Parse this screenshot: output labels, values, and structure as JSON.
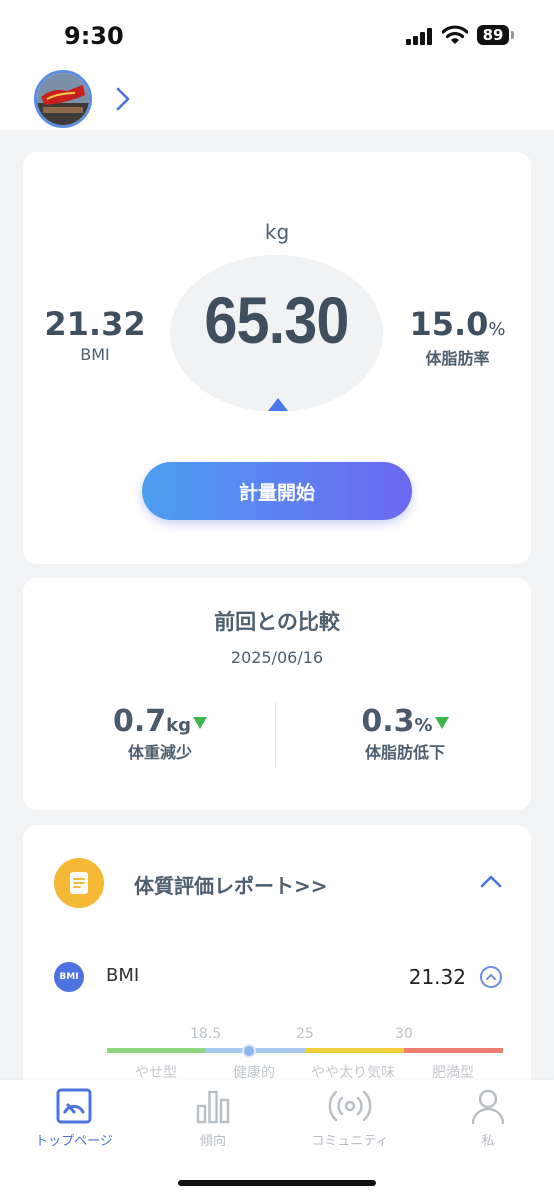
{
  "status_bar": {
    "time": "9:30",
    "battery": "89"
  },
  "weight_card": {
    "unit": "kg",
    "weight": "65.30",
    "bmi_value": "21.32",
    "bmi_label": "BMI",
    "body_fat_value": "15.0",
    "body_fat_unit": "%",
    "body_fat_label": "体脂肪率",
    "start_button": "計量開始"
  },
  "comparison": {
    "title": "前回との比較",
    "date": "2025/06/16",
    "weight_change_value": "0.7",
    "weight_change_unit": "kg",
    "weight_change_label": "体重減少",
    "fat_change_value": "0.3",
    "fat_change_unit": "%",
    "fat_change_label": "体脂肪低下"
  },
  "report": {
    "title": "体質評価レポート>>",
    "bmi_badge": "BMI",
    "bmi_name": "BMI",
    "bmi_value": "21.32",
    "scale_ticks": [
      "18.5",
      "25",
      "30"
    ],
    "scale_ranges": [
      "やせ型",
      "健康的",
      "やや太り気味",
      "肥満型"
    ],
    "scale_colors": [
      "#8dd67f",
      "#a9c8f0",
      "#f0cf3c",
      "#ef7e70"
    ]
  },
  "tabs": [
    {
      "label": "トップページ",
      "icon": "gauge-icon",
      "active": true
    },
    {
      "label": "傾向",
      "icon": "bar-chart-icon",
      "active": false
    },
    {
      "label": "コミュニティ",
      "icon": "broadcast-icon",
      "active": false
    },
    {
      "label": "私",
      "icon": "person-icon",
      "active": false
    }
  ],
  "colors": {
    "accent": "#4c73e0",
    "down_arrow": "#3db54a"
  }
}
